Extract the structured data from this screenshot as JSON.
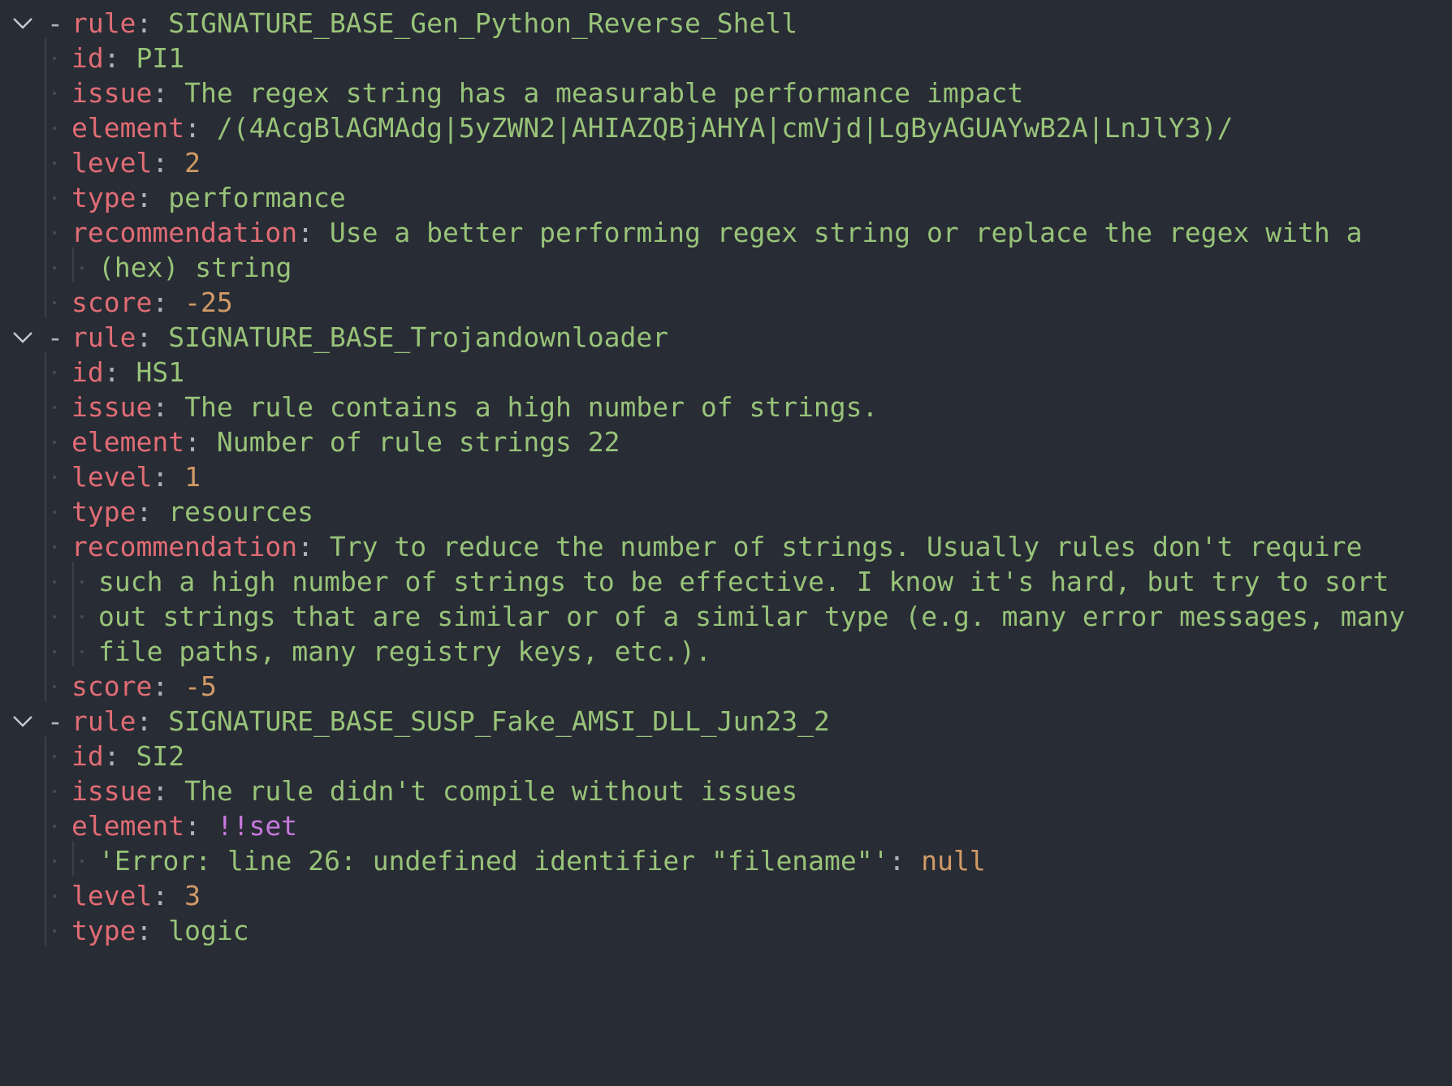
{
  "editor": {
    "colors": {
      "background": "#282c34",
      "key": "#e06c75",
      "string": "#98c379",
      "number": "#d19a66",
      "tag": "#c678dd",
      "punctuation": "#abb2bf"
    },
    "fold_icon": "chevron-down-icon",
    "lines": [
      {
        "type": "item",
        "key": "rule",
        "value": "SIGNATURE_BASE_Gen_Python_Reverse_Shell",
        "vclass": "s"
      },
      {
        "type": "kv",
        "key": "id",
        "value": "PI1",
        "vclass": "s"
      },
      {
        "type": "kv",
        "key": "issue",
        "value": "The regex string has a measurable performance impact",
        "vclass": "s"
      },
      {
        "type": "kv",
        "key": "element",
        "value": "/(4AcgBlAGMAdg|5yZWN2|AHIAZQBjAHYA|cmVjd|LgByAGUAYwB2A|LnJlY3)/",
        "vclass": "s"
      },
      {
        "type": "kv",
        "key": "level",
        "value": "2",
        "vclass": "n"
      },
      {
        "type": "kv",
        "key": "type",
        "value": "performance",
        "vclass": "s"
      },
      {
        "type": "kv",
        "key": "recommendation",
        "value": "Use a better performing regex string or replace the regex with a",
        "vclass": "s"
      },
      {
        "type": "cont",
        "value": "(hex) string",
        "vclass": "s"
      },
      {
        "type": "kv",
        "key": "score",
        "value": "-25",
        "vclass": "n"
      },
      {
        "type": "item",
        "key": "rule",
        "value": "SIGNATURE_BASE_Trojandownloader",
        "vclass": "s"
      },
      {
        "type": "kv",
        "key": "id",
        "value": "HS1",
        "vclass": "s"
      },
      {
        "type": "kv",
        "key": "issue",
        "value": "The rule contains a high number of strings.",
        "vclass": "s"
      },
      {
        "type": "kv",
        "key": "element",
        "value": "Number of rule strings 22",
        "vclass": "s"
      },
      {
        "type": "kv",
        "key": "level",
        "value": "1",
        "vclass": "n"
      },
      {
        "type": "kv",
        "key": "type",
        "value": "resources",
        "vclass": "s"
      },
      {
        "type": "kv",
        "key": "recommendation",
        "value": "Try to reduce the number of strings. Usually rules don't require",
        "vclass": "s"
      },
      {
        "type": "cont",
        "value": "such a high number of strings to be effective. I know it's hard, but try to sort",
        "vclass": "s"
      },
      {
        "type": "cont",
        "value": "out strings that are similar or of a similar type (e.g. many error messages, many",
        "vclass": "s"
      },
      {
        "type": "cont",
        "value": "file paths, many registry keys, etc.).",
        "vclass": "s"
      },
      {
        "type": "kv",
        "key": "score",
        "value": "-5",
        "vclass": "n"
      },
      {
        "type": "item",
        "key": "rule",
        "value": "SIGNATURE_BASE_SUSP_Fake_AMSI_DLL_Jun23_2",
        "vclass": "s"
      },
      {
        "type": "kv",
        "key": "id",
        "value": "SI2",
        "vclass": "s"
      },
      {
        "type": "kv",
        "key": "issue",
        "value": "The rule didn't compile without issues",
        "vclass": "s"
      },
      {
        "type": "kv",
        "key": "element",
        "value": "!!set",
        "vclass": "t"
      },
      {
        "type": "cont",
        "value": "'Error: line 26: undefined identifier \"filename\"'",
        "vclass": "s",
        "suffix": ": ",
        "extra": "null",
        "extraclass": "n"
      },
      {
        "type": "kv",
        "key": "level",
        "value": "3",
        "vclass": "n"
      },
      {
        "type": "kv",
        "key": "type",
        "value": "logic",
        "vclass": "s"
      }
    ]
  }
}
